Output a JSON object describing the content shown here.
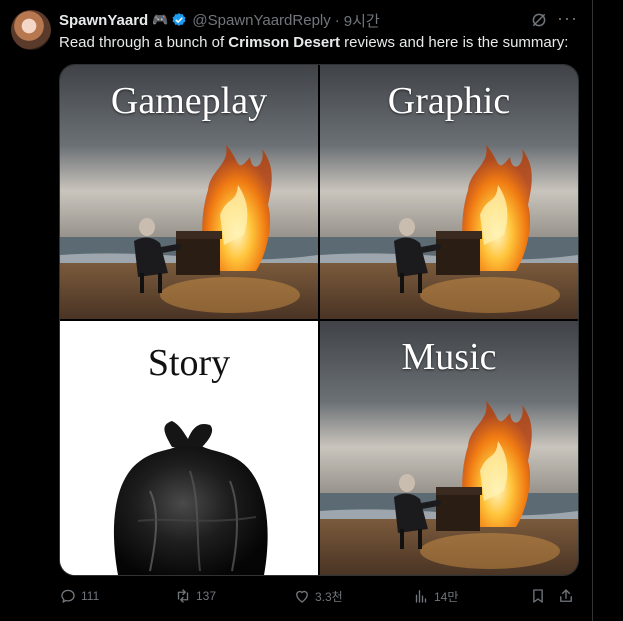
{
  "tweet": {
    "author_name": "SpawnYaard",
    "badge": "🎮",
    "handle": "@SpawnYaardReply",
    "separator": "·",
    "time": "9시간",
    "text_before": "Read through a bunch of ",
    "text_bold": "Crimson Desert",
    "text_after": " reviews and here is the summary:"
  },
  "meme": {
    "panels": [
      {
        "label": "Gameplay",
        "image": "burning-piano-on-beach"
      },
      {
        "label": "Graphic",
        "image": "burning-piano-on-beach"
      },
      {
        "label": "Story",
        "image": "black-garbage-bag"
      },
      {
        "label": "Music",
        "image": "burning-piano-on-beach"
      }
    ]
  },
  "actions": {
    "replies": "111",
    "reposts": "137",
    "likes": "3.3천",
    "views": "14만"
  },
  "colors": {
    "background": "#000000",
    "text": "#e7e9ea",
    "muted": "#71767b",
    "verified": "#1d9bf0"
  }
}
